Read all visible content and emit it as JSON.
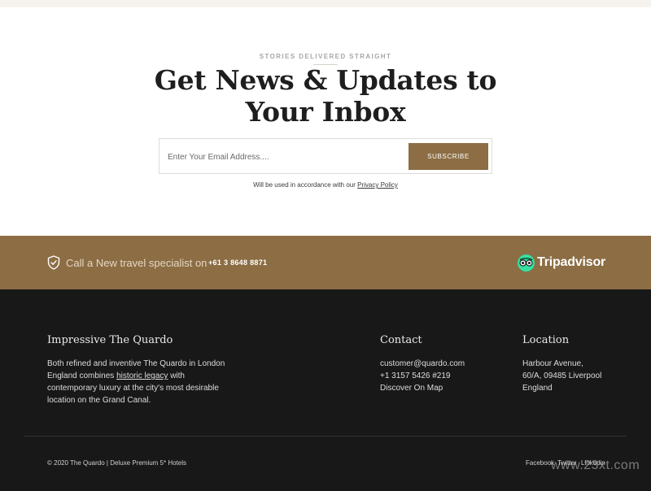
{
  "newsletter": {
    "eyebrow": "STORIES DELIVERED STRAIGHT",
    "headline_line1": "Get News & Updates to",
    "headline_line2": "Your Inbox",
    "email_placeholder": "Enter Your Email Address....",
    "subscribe_label": "SUBSCRIBE",
    "policy_prefix": "Will be used in accordance with our",
    "policy_link": "Privacy Policy"
  },
  "band": {
    "shield_icon": "shield-check-icon",
    "text": "Call a New travel specialist on",
    "phone": "+61 3 8648 8871",
    "tripadvisor_icon": "owl-eyes-icon",
    "tripadvisor_label": "Tripadvisor"
  },
  "footer": {
    "about": {
      "title": "Impressive The Quardo",
      "line1": "Both refined and inventive The Quardo in London",
      "line2_prefix": "England combines",
      "line2_link": "historic legacy",
      "line2_suffix": "with",
      "line3": "contemporary luxury at the city's most desirable",
      "line4": "location on the Grand Canal."
    },
    "contact": {
      "title": "Contact",
      "email": "customer@quardo.com",
      "phone": "+1 3157 5426 #219",
      "map_link": "Discover On Map"
    },
    "location": {
      "title": "Location",
      "line1": "Harbour Avenue,",
      "line2": "60/A, 09485 Liverpool",
      "line3": "England"
    },
    "copyright": "© 2020 The Quardo | Deluxe Premium 5* Hotels",
    "social": [
      "Facebook",
      "Twitter",
      "Linkedin"
    ],
    "watermark": "www.23xt.com"
  },
  "colors": {
    "brand_gold": "#8c6d44",
    "footer_bg": "#181818",
    "tripadvisor_green": "#34e0a1"
  }
}
